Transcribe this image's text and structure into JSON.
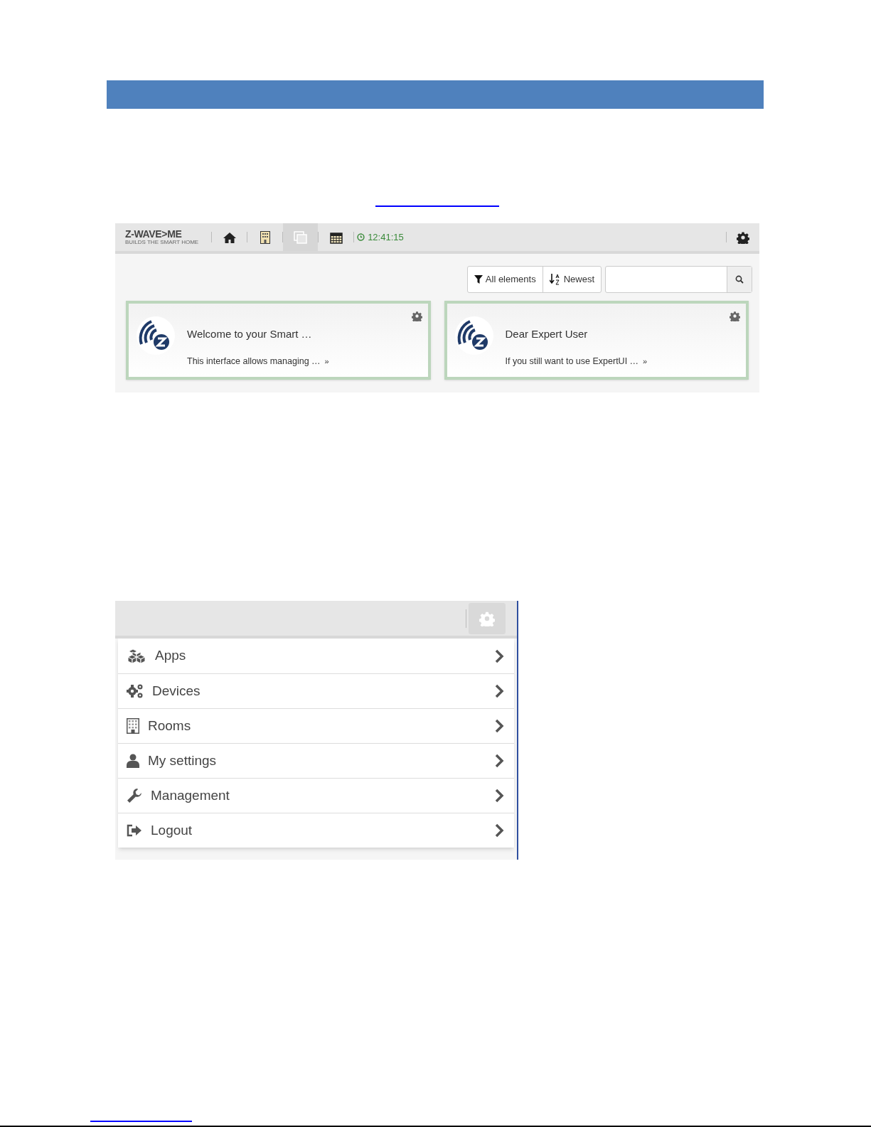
{
  "dashboard": {
    "logo": "Z-WAVE>ME",
    "tagline": "BUILDS THE SMART HOME",
    "nav": [
      {
        "kind": "home",
        "selected": false
      },
      {
        "kind": "rooms",
        "selected": false
      },
      {
        "kind": "elements",
        "selected": true
      },
      {
        "kind": "events",
        "selected": false
      }
    ],
    "clock": "12:41:15",
    "filter": "All elements",
    "sort": "Newest",
    "cards": [
      {
        "title": "Welcome to your Smart …",
        "text": "This interface allows managing …",
        "more": "»"
      },
      {
        "title": "Dear Expert User",
        "text": "If you still want to use ExpertUI …",
        "more": "»"
      }
    ]
  },
  "menu": {
    "settings_selected": true,
    "items": [
      {
        "kind": "apps",
        "label": "Apps"
      },
      {
        "kind": "devices",
        "label": "Devices"
      },
      {
        "kind": "rooms",
        "label": "Rooms"
      },
      {
        "kind": "user",
        "label": "My settings"
      },
      {
        "kind": "wrench",
        "label": "Management"
      },
      {
        "kind": "logout",
        "label": "Logout"
      }
    ]
  }
}
